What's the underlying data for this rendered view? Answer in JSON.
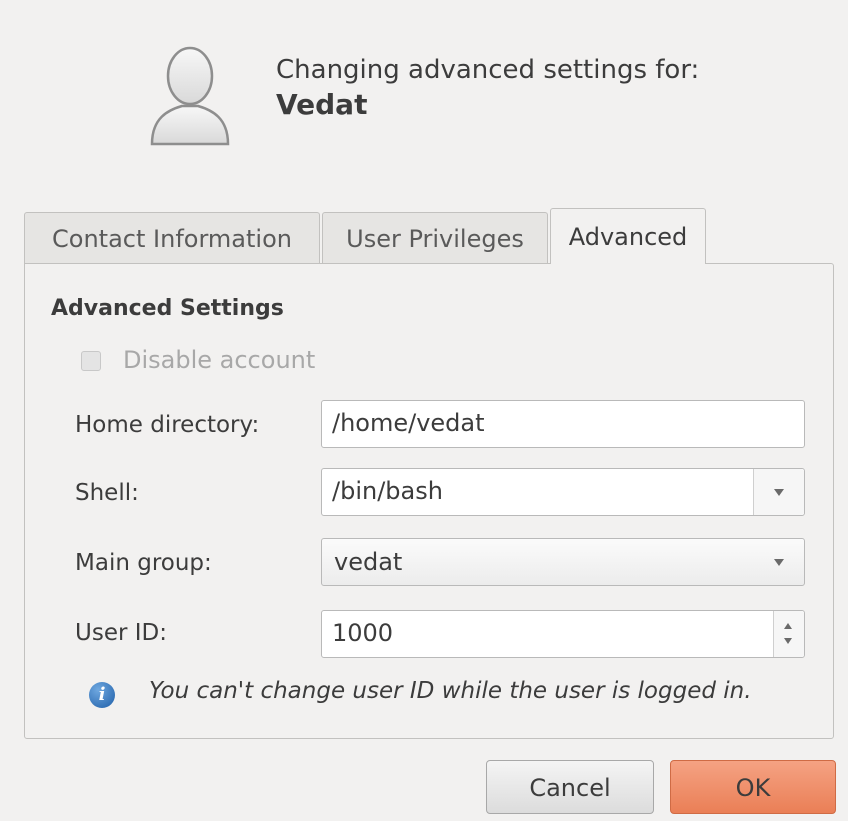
{
  "header": {
    "line1": "Changing advanced settings for:",
    "user_name": "Vedat",
    "avatar_icon": "user-avatar-icon"
  },
  "tabs": [
    {
      "label": "Contact Information",
      "active": false
    },
    {
      "label": "User Privileges",
      "active": false
    },
    {
      "label": "Advanced",
      "active": true
    }
  ],
  "advanced": {
    "section_title": "Advanced Settings",
    "disable_account": {
      "label": "Disable account",
      "checked": false,
      "enabled": false
    },
    "home_directory": {
      "label": "Home directory:",
      "value": "/home/vedat"
    },
    "shell": {
      "label": "Shell:",
      "value": "/bin/bash"
    },
    "main_group": {
      "label": "Main group:",
      "value": "vedat"
    },
    "user_id": {
      "label": "User ID:",
      "value": "1000"
    },
    "info_icon": "info-icon",
    "info_message": "You can't change user ID while the user is logged in."
  },
  "buttons": {
    "cancel": "Cancel",
    "ok": "OK"
  },
  "colors": {
    "window_bg": "#f2f1f0",
    "ok_accent": "#ea7f56",
    "info_blue": "#1f5fa8"
  }
}
